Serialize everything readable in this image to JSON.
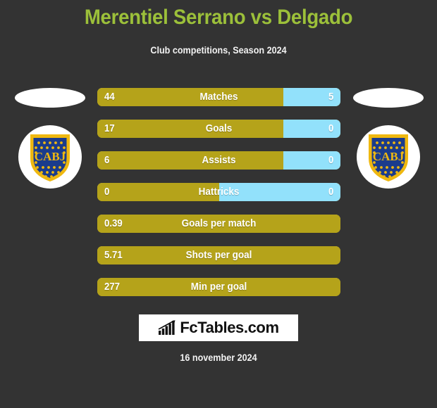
{
  "header": {
    "title": "Merentiel Serrano vs Delgado",
    "subtitle": "Club competitions, Season 2024",
    "title_color": "#9CC03A"
  },
  "theme": {
    "background": "#333333",
    "bar_left_color": "#B5A31A",
    "bar_right_color": "#92E1FB",
    "text_color": "#FFFFFF"
  },
  "players": {
    "left": {
      "club_badge_text": "CABJ",
      "badge_shield_color": "#1B3C8C",
      "badge_outline_color": "#EFB810",
      "photo_placeholder": ""
    },
    "right": {
      "club_badge_text": "CABJ",
      "badge_shield_color": "#1B3C8C",
      "badge_outline_color": "#EFB810",
      "photo_placeholder": ""
    }
  },
  "chart_data": {
    "type": "bar",
    "title": "Merentiel Serrano vs Delgado",
    "subtitle": "Club competitions, Season 2024",
    "categories": [
      "Matches",
      "Goals",
      "Assists",
      "Hattricks",
      "Goals per match",
      "Shots per goal",
      "Min per goal"
    ],
    "series": [
      {
        "name": "Merentiel Serrano",
        "values": [
          "44",
          "17",
          "6",
          "0",
          "0.39",
          "5.71",
          "277"
        ]
      },
      {
        "name": "Delgado",
        "values": [
          "5",
          "0",
          "0",
          "0",
          null,
          null,
          null
        ]
      }
    ],
    "legend": "none",
    "grid": false
  },
  "stats": [
    {
      "label": "Matches",
      "left_value": "44",
      "right_value": "5",
      "left_pct": 76.5,
      "comparison": true
    },
    {
      "label": "Goals",
      "left_value": "17",
      "right_value": "0",
      "left_pct": 76.5,
      "comparison": true
    },
    {
      "label": "Assists",
      "left_value": "6",
      "right_value": "0",
      "left_pct": 76.5,
      "comparison": true
    },
    {
      "label": "Hattricks",
      "left_value": "0",
      "right_value": "0",
      "left_pct": 50.0,
      "comparison": true
    },
    {
      "label": "Goals per match",
      "left_value": "0.39",
      "right_value": "",
      "left_pct": 100,
      "comparison": false
    },
    {
      "label": "Shots per goal",
      "left_value": "5.71",
      "right_value": "",
      "left_pct": 100,
      "comparison": false
    },
    {
      "label": "Min per goal",
      "left_value": "277",
      "right_value": "",
      "left_pct": 100,
      "comparison": false
    }
  ],
  "footer": {
    "logo_text": "FcTables.com",
    "logo_icon": "bar-chart-growth-icon",
    "date": "16 november 2024"
  }
}
